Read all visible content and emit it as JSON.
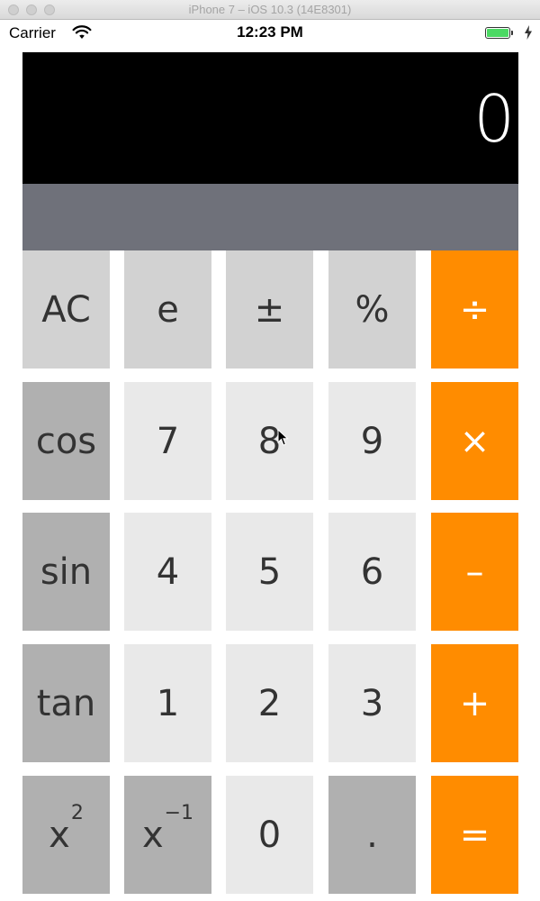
{
  "window": {
    "title": "iPhone 7 – iOS 10.3 (14E8301)"
  },
  "status_bar": {
    "carrier": "Carrier",
    "time": "12:23 PM",
    "wifi_icon": "wifi-icon",
    "battery_icon": "battery-icon",
    "charging_icon": "charging-bolt-icon",
    "battery_level": 1.0
  },
  "display": {
    "value": "0",
    "secondary": ""
  },
  "keys": {
    "ac": "AC",
    "e": "e",
    "plus_minus": "±",
    "percent": "%",
    "divide": "÷",
    "cos": "cos",
    "seven": "7",
    "eight": "8",
    "nine": "9",
    "multiply": "×",
    "sin": "sin",
    "four": "4",
    "five": "5",
    "six": "6",
    "minus": "–",
    "tan": "tan",
    "one": "1",
    "two": "2",
    "three": "3",
    "plus": "+",
    "square_base": "x",
    "square_exp": "2",
    "reciprocal_base": "x",
    "reciprocal_exp": "−1",
    "zero": "0",
    "decimal": ".",
    "equals": "="
  },
  "colors": {
    "display_bg": "#000000",
    "secondary_display_bg": "#6f717a",
    "function_key": "#d2d2d2",
    "scientific_key": "#b0b0b0",
    "number_key": "#e9e9e9",
    "operator_key": "#ff8c00"
  }
}
